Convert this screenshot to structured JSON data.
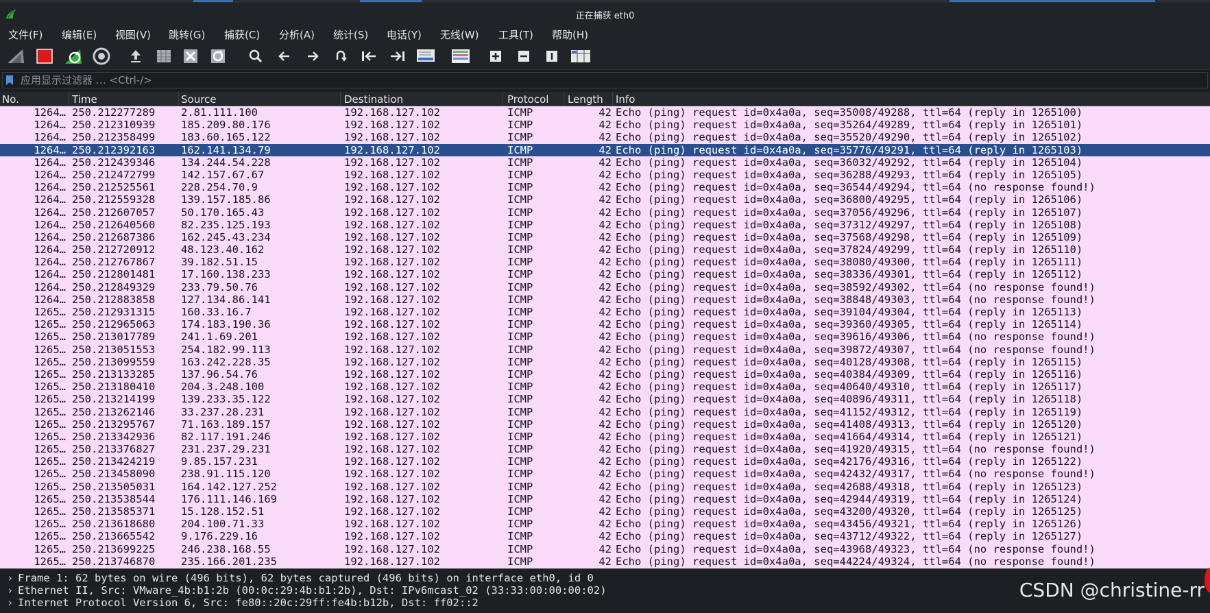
{
  "window": {
    "title": "正在捕获 eth0"
  },
  "menu": [
    "文件(F)",
    "编辑(E)",
    "视图(V)",
    "跳转(G)",
    "捕获(C)",
    "分析(A)",
    "统计(S)",
    "电话(Y)",
    "无线(W)",
    "工具(T)",
    "帮助(H)"
  ],
  "toolbar": {
    "icons": [
      "shark-fin-icon",
      "stop-capture-icon",
      "restart-capture-icon",
      "capture-options-icon",
      "open-file-icon",
      "save-file-icon",
      "close-file-icon",
      "reload-file-icon",
      "find-packet-icon",
      "go-back-icon",
      "go-forward-icon",
      "go-to-packet-icon",
      "go-first-icon",
      "go-last-icon",
      "autoscroll-icon",
      "colorize-icon",
      "zoom-in-icon",
      "zoom-out-icon",
      "normal-size-icon",
      "resize-columns-icon"
    ]
  },
  "filter": {
    "placeholder": "应用显示过滤器 … <Ctrl-/>"
  },
  "columns": [
    "No.",
    "Time",
    "Source",
    "Destination",
    "Protocol",
    "Length",
    "Info"
  ],
  "colors": {
    "row_bg": "#fadcfa",
    "selected_bg": "#2a4f8f",
    "chrome_bg": "#202327"
  },
  "packets": [
    {
      "no": "1264…",
      "time": "250.212277289",
      "src": "2.81.111.100",
      "dst": "192.168.127.102",
      "proto": "ICMP",
      "len": "42",
      "info": "Echo (ping) request  id=0x4a0a, seq=35008/49288, ttl=64 (reply in 1265100)"
    },
    {
      "no": "1264…",
      "time": "250.212310939",
      "src": "185.209.80.176",
      "dst": "192.168.127.102",
      "proto": "ICMP",
      "len": "42",
      "info": "Echo (ping) request  id=0x4a0a, seq=35264/49289, ttl=64 (reply in 1265101)"
    },
    {
      "no": "1264…",
      "time": "250.212358499",
      "src": "183.60.165.122",
      "dst": "192.168.127.102",
      "proto": "ICMP",
      "len": "42",
      "info": "Echo (ping) request  id=0x4a0a, seq=35520/49290, ttl=64 (reply in 1265102)"
    },
    {
      "no": "1264…",
      "time": "250.212392163",
      "src": "162.141.134.79",
      "dst": "192.168.127.102",
      "proto": "ICMP",
      "len": "42",
      "info": "Echo (ping) request  id=0x4a0a, seq=35776/49291, ttl=64 (reply in 1265103)",
      "selected": true
    },
    {
      "no": "1264…",
      "time": "250.212439346",
      "src": "134.244.54.228",
      "dst": "192.168.127.102",
      "proto": "ICMP",
      "len": "42",
      "info": "Echo (ping) request  id=0x4a0a, seq=36032/49292, ttl=64 (reply in 1265104)"
    },
    {
      "no": "1264…",
      "time": "250.212472799",
      "src": "142.157.67.67",
      "dst": "192.168.127.102",
      "proto": "ICMP",
      "len": "42",
      "info": "Echo (ping) request  id=0x4a0a, seq=36288/49293, ttl=64 (reply in 1265105)"
    },
    {
      "no": "1264…",
      "time": "250.212525561",
      "src": "228.254.70.9",
      "dst": "192.168.127.102",
      "proto": "ICMP",
      "len": "42",
      "info": "Echo (ping) request  id=0x4a0a, seq=36544/49294, ttl=64 (no response found!)"
    },
    {
      "no": "1264…",
      "time": "250.212559328",
      "src": "139.157.185.86",
      "dst": "192.168.127.102",
      "proto": "ICMP",
      "len": "42",
      "info": "Echo (ping) request  id=0x4a0a, seq=36800/49295, ttl=64 (reply in 1265106)"
    },
    {
      "no": "1264…",
      "time": "250.212607057",
      "src": "50.170.165.43",
      "dst": "192.168.127.102",
      "proto": "ICMP",
      "len": "42",
      "info": "Echo (ping) request  id=0x4a0a, seq=37056/49296, ttl=64 (reply in 1265107)"
    },
    {
      "no": "1264…",
      "time": "250.212640560",
      "src": "82.235.125.193",
      "dst": "192.168.127.102",
      "proto": "ICMP",
      "len": "42",
      "info": "Echo (ping) request  id=0x4a0a, seq=37312/49297, ttl=64 (reply in 1265108)"
    },
    {
      "no": "1264…",
      "time": "250.212687386",
      "src": "162.245.43.234",
      "dst": "192.168.127.102",
      "proto": "ICMP",
      "len": "42",
      "info": "Echo (ping) request  id=0x4a0a, seq=37568/49298, ttl=64 (reply in 1265109)"
    },
    {
      "no": "1264…",
      "time": "250.212720912",
      "src": "48.123.40.162",
      "dst": "192.168.127.102",
      "proto": "ICMP",
      "len": "42",
      "info": "Echo (ping) request  id=0x4a0a, seq=37824/49299, ttl=64 (reply in 1265110)"
    },
    {
      "no": "1264…",
      "time": "250.212767867",
      "src": "39.182.51.15",
      "dst": "192.168.127.102",
      "proto": "ICMP",
      "len": "42",
      "info": "Echo (ping) request  id=0x4a0a, seq=38080/49300, ttl=64 (reply in 1265111)"
    },
    {
      "no": "1264…",
      "time": "250.212801481",
      "src": "17.160.138.233",
      "dst": "192.168.127.102",
      "proto": "ICMP",
      "len": "42",
      "info": "Echo (ping) request  id=0x4a0a, seq=38336/49301, ttl=64 (reply in 1265112)"
    },
    {
      "no": "1264…",
      "time": "250.212849329",
      "src": "233.79.50.76",
      "dst": "192.168.127.102",
      "proto": "ICMP",
      "len": "42",
      "info": "Echo (ping) request  id=0x4a0a, seq=38592/49302, ttl=64 (no response found!)"
    },
    {
      "no": "1264…",
      "time": "250.212883858",
      "src": "127.134.86.141",
      "dst": "192.168.127.102",
      "proto": "ICMP",
      "len": "42",
      "info": "Echo (ping) request  id=0x4a0a, seq=38848/49303, ttl=64 (no response found!)"
    },
    {
      "no": "1265…",
      "time": "250.212931315",
      "src": "160.33.16.7",
      "dst": "192.168.127.102",
      "proto": "ICMP",
      "len": "42",
      "info": "Echo (ping) request  id=0x4a0a, seq=39104/49304, ttl=64 (reply in 1265113)"
    },
    {
      "no": "1265…",
      "time": "250.212965063",
      "src": "174.183.190.36",
      "dst": "192.168.127.102",
      "proto": "ICMP",
      "len": "42",
      "info": "Echo (ping) request  id=0x4a0a, seq=39360/49305, ttl=64 (reply in 1265114)"
    },
    {
      "no": "1265…",
      "time": "250.213017789",
      "src": "241.1.69.201",
      "dst": "192.168.127.102",
      "proto": "ICMP",
      "len": "42",
      "info": "Echo (ping) request  id=0x4a0a, seq=39616/49306, ttl=64 (no response found!)"
    },
    {
      "no": "1265…",
      "time": "250.213051553",
      "src": "254.182.99.113",
      "dst": "192.168.127.102",
      "proto": "ICMP",
      "len": "42",
      "info": "Echo (ping) request  id=0x4a0a, seq=39872/49307, ttl=64 (no response found!)"
    },
    {
      "no": "1265…",
      "time": "250.213099559",
      "src": "163.242.228.35",
      "dst": "192.168.127.102",
      "proto": "ICMP",
      "len": "42",
      "info": "Echo (ping) request  id=0x4a0a, seq=40128/49308, ttl=64 (reply in 1265115)"
    },
    {
      "no": "1265…",
      "time": "250.213133285",
      "src": "137.96.54.76",
      "dst": "192.168.127.102",
      "proto": "ICMP",
      "len": "42",
      "info": "Echo (ping) request  id=0x4a0a, seq=40384/49309, ttl=64 (reply in 1265116)"
    },
    {
      "no": "1265…",
      "time": "250.213180410",
      "src": "204.3.248.100",
      "dst": "192.168.127.102",
      "proto": "ICMP",
      "len": "42",
      "info": "Echo (ping) request  id=0x4a0a, seq=40640/49310, ttl=64 (reply in 1265117)"
    },
    {
      "no": "1265…",
      "time": "250.213214199",
      "src": "139.233.35.122",
      "dst": "192.168.127.102",
      "proto": "ICMP",
      "len": "42",
      "info": "Echo (ping) request  id=0x4a0a, seq=40896/49311, ttl=64 (reply in 1265118)"
    },
    {
      "no": "1265…",
      "time": "250.213262146",
      "src": "33.237.28.231",
      "dst": "192.168.127.102",
      "proto": "ICMP",
      "len": "42",
      "info": "Echo (ping) request  id=0x4a0a, seq=41152/49312, ttl=64 (reply in 1265119)"
    },
    {
      "no": "1265…",
      "time": "250.213295767",
      "src": "71.163.189.157",
      "dst": "192.168.127.102",
      "proto": "ICMP",
      "len": "42",
      "info": "Echo (ping) request  id=0x4a0a, seq=41408/49313, ttl=64 (reply in 1265120)"
    },
    {
      "no": "1265…",
      "time": "250.213342936",
      "src": "82.117.191.246",
      "dst": "192.168.127.102",
      "proto": "ICMP",
      "len": "42",
      "info": "Echo (ping) request  id=0x4a0a, seq=41664/49314, ttl=64 (reply in 1265121)"
    },
    {
      "no": "1265…",
      "time": "250.213376827",
      "src": "231.237.29.231",
      "dst": "192.168.127.102",
      "proto": "ICMP",
      "len": "42",
      "info": "Echo (ping) request  id=0x4a0a, seq=41920/49315, ttl=64 (no response found!)"
    },
    {
      "no": "1265…",
      "time": "250.213424219",
      "src": "9.85.157.231",
      "dst": "192.168.127.102",
      "proto": "ICMP",
      "len": "42",
      "info": "Echo (ping) request  id=0x4a0a, seq=42176/49316, ttl=64 (reply in 1265122)"
    },
    {
      "no": "1265…",
      "time": "250.213458090",
      "src": "238.91.115.120",
      "dst": "192.168.127.102",
      "proto": "ICMP",
      "len": "42",
      "info": "Echo (ping) request  id=0x4a0a, seq=42432/49317, ttl=64 (no response found!)"
    },
    {
      "no": "1265…",
      "time": "250.213505031",
      "src": "164.142.127.252",
      "dst": "192.168.127.102",
      "proto": "ICMP",
      "len": "42",
      "info": "Echo (ping) request  id=0x4a0a, seq=42688/49318, ttl=64 (reply in 1265123)"
    },
    {
      "no": "1265…",
      "time": "250.213538544",
      "src": "176.111.146.169",
      "dst": "192.168.127.102",
      "proto": "ICMP",
      "len": "42",
      "info": "Echo (ping) request  id=0x4a0a, seq=42944/49319, ttl=64 (reply in 1265124)"
    },
    {
      "no": "1265…",
      "time": "250.213585371",
      "src": "15.128.152.51",
      "dst": "192.168.127.102",
      "proto": "ICMP",
      "len": "42",
      "info": "Echo (ping) request  id=0x4a0a, seq=43200/49320, ttl=64 (reply in 1265125)"
    },
    {
      "no": "1265…",
      "time": "250.213618680",
      "src": "204.100.71.33",
      "dst": "192.168.127.102",
      "proto": "ICMP",
      "len": "42",
      "info": "Echo (ping) request  id=0x4a0a, seq=43456/49321, ttl=64 (reply in 1265126)"
    },
    {
      "no": "1265…",
      "time": "250.213665542",
      "src": "9.176.229.16",
      "dst": "192.168.127.102",
      "proto": "ICMP",
      "len": "42",
      "info": "Echo (ping) request  id=0x4a0a, seq=43712/49322, ttl=64 (reply in 1265127)"
    },
    {
      "no": "1265…",
      "time": "250.213699225",
      "src": "246.238.168.55",
      "dst": "192.168.127.102",
      "proto": "ICMP",
      "len": "42",
      "info": "Echo (ping) request  id=0x4a0a, seq=43968/49323, ttl=64 (no response found!)"
    },
    {
      "no": "1265…",
      "time": "250.213746870",
      "src": "235.166.201.235",
      "dst": "192.168.127.102",
      "proto": "ICMP",
      "len": "42",
      "info": "Echo (ping) request  id=0x4a0a, seq=44224/49324, ttl=64 (no response found!)"
    }
  ],
  "details": [
    "Frame 1: 62 bytes on wire (496 bits), 62 bytes captured (496 bits) on interface eth0, id 0",
    "Ethernet II, Src: VMware_4b:b1:2b (00:0c:29:4b:b1:2b), Dst: IPv6mcast_02 (33:33:00:00:00:02)",
    "Internet Protocol Version 6, Src: fe80::20c:29ff:fe4b:b12b, Dst: ff02::2"
  ],
  "watermark": "CSDN @christine-rr"
}
